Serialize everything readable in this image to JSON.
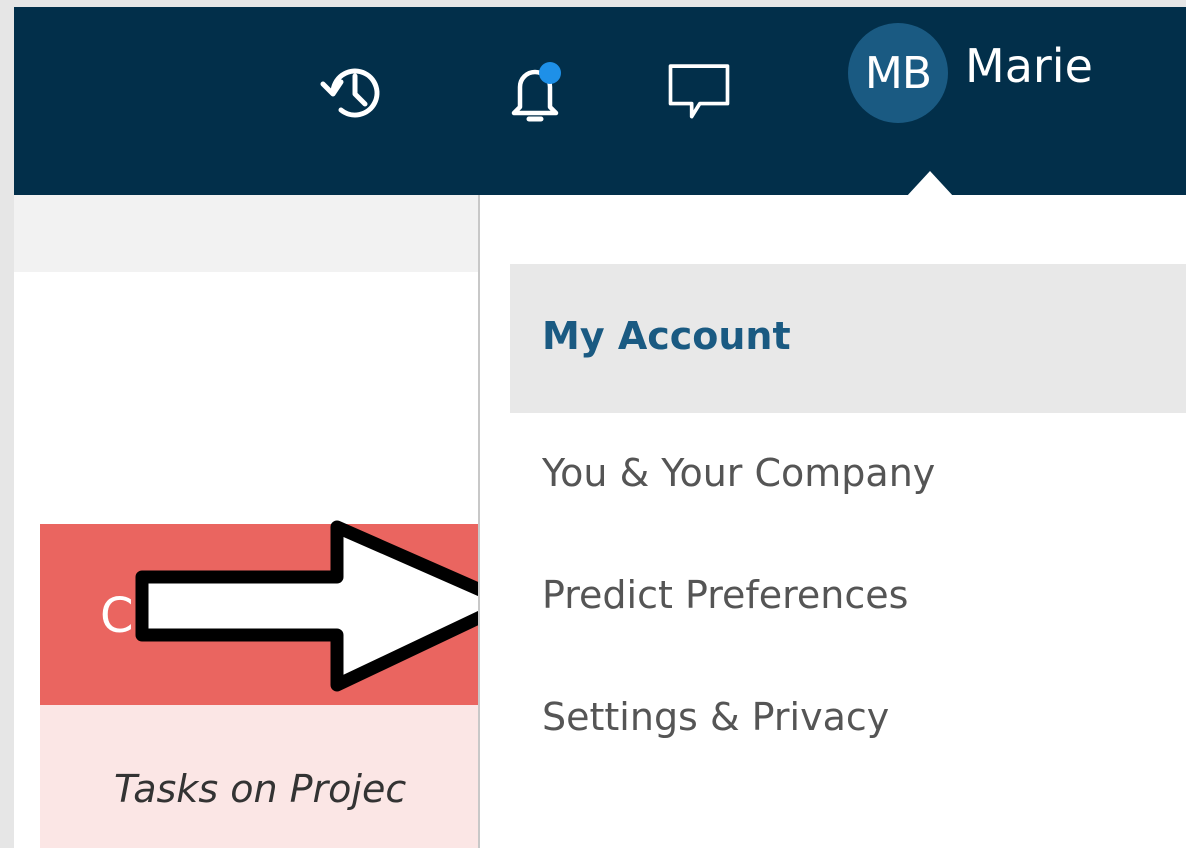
{
  "header": {
    "icons": {
      "history": "history-icon",
      "notifications": "bell-icon",
      "messages": "chat-icon"
    },
    "user": {
      "initials": "MB",
      "name": "Marie"
    },
    "colors": {
      "background": "#022f4a",
      "avatar": "#1a5a82",
      "notification_dot": "#1e90e8"
    }
  },
  "card": {
    "title_partial": "C",
    "body_text": "Tasks on Projec",
    "colors": {
      "header": "#ea6560",
      "body": "#fbe6e5"
    }
  },
  "menu": {
    "header": "My Account",
    "items": [
      "You & Your Company",
      "Predict Preferences",
      "Settings & Privacy"
    ],
    "colors": {
      "header_text": "#1a5a82",
      "header_bg": "#e8e8e8",
      "item_text": "#555555"
    }
  },
  "annotation": {
    "type": "arrow",
    "points_to": "Predict Preferences"
  }
}
